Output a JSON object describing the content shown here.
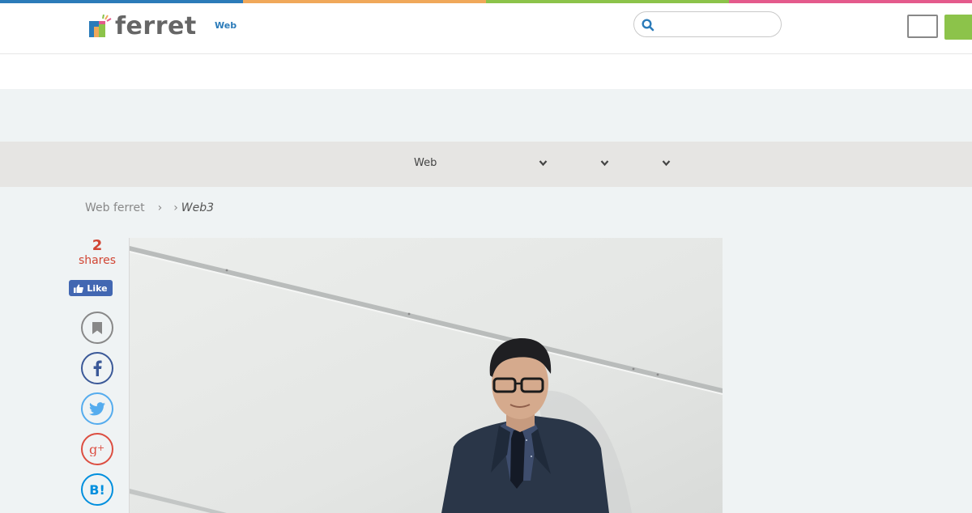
{
  "brand": {
    "name": "ferret",
    "subtitle": "Web",
    "top_bar_colors": [
      "#2b7bb9",
      "#f0a85a",
      "#8cc34a",
      "#e45a8c"
    ]
  },
  "search": {
    "placeholder": ""
  },
  "nav": {
    "items": [
      {
        "label": "Web",
        "has_dropdown": false
      },
      {
        "label": "",
        "has_dropdown": true
      },
      {
        "label": "",
        "has_dropdown": true
      },
      {
        "label": "",
        "has_dropdown": true
      }
    ]
  },
  "breadcrumb": {
    "home": "Web ferret",
    "current": "Web3"
  },
  "social": {
    "share_count": "2",
    "share_label": "shares",
    "like_label": "Like",
    "buttons": [
      "bookmark-icon",
      "facebook-icon",
      "twitter-icon",
      "google-plus-icon",
      "hatena-bookmark-icon"
    ],
    "hatena_text": "B!"
  },
  "hero": {
    "subject": "man-in-suit-leaning-on-wall"
  },
  "colors": {
    "accent_blue": "#2b7bb9",
    "share_red": "#d14533",
    "facebook": "#3b5998",
    "twitter": "#55acee",
    "google_plus": "#dc4e41",
    "hatena": "#008fde",
    "signup_green": "#8cc34a"
  }
}
